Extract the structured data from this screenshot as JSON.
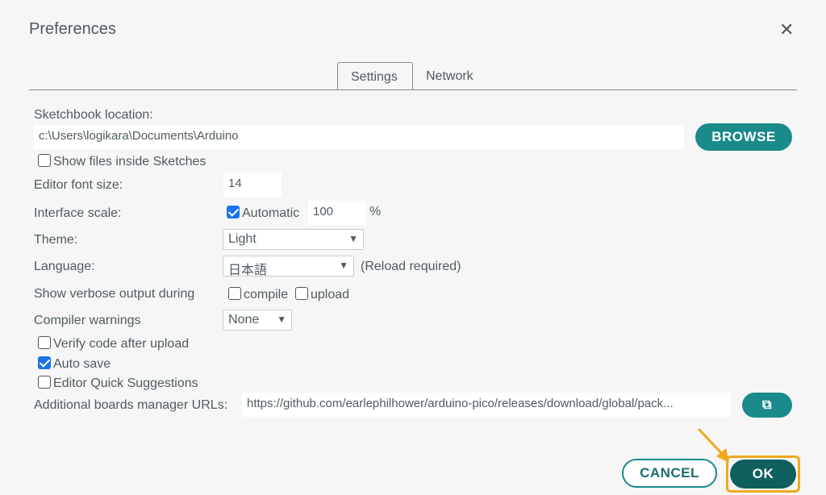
{
  "dialog": {
    "title": "Preferences",
    "close_icon": "close-icon"
  },
  "tabs": [
    {
      "label": "Settings",
      "active": true
    },
    {
      "label": "Network",
      "active": false
    }
  ],
  "sketchbook": {
    "label": "Sketchbook location:",
    "value": "c:\\Users\\logikara\\Documents\\Arduino",
    "browse": "BROWSE"
  },
  "show_files": {
    "label": "Show files inside Sketches",
    "checked": false
  },
  "font_size": {
    "label": "Editor font size:",
    "value": "14"
  },
  "scale": {
    "label": "Interface scale:",
    "auto_label": "Automatic",
    "auto_checked": true,
    "value": "100",
    "unit": "%"
  },
  "theme": {
    "label": "Theme:",
    "value": "Light"
  },
  "language": {
    "label": "Language:",
    "value": "日本語",
    "note": "(Reload required)"
  },
  "verbose": {
    "label": "Show verbose output during",
    "compile": "compile",
    "compile_checked": false,
    "upload": "upload",
    "upload_checked": false
  },
  "warnings": {
    "label": "Compiler warnings",
    "value": "None"
  },
  "verify": {
    "label": "Verify code after upload",
    "checked": false
  },
  "autosave": {
    "label": "Auto save",
    "checked": true
  },
  "quick": {
    "label": "Editor Quick Suggestions",
    "checked": false
  },
  "boards": {
    "label": "Additional boards manager URLs:",
    "value": "https://github.com/earlephilhower/arduino-pico/releases/download/global/pack...",
    "icon": "open-window-icon"
  },
  "footer": {
    "cancel": "CANCEL",
    "ok": "OK"
  },
  "colors": {
    "accent": "#1a8a8a",
    "ok": "#0f5f5f",
    "highlight": "#f0a81e"
  }
}
